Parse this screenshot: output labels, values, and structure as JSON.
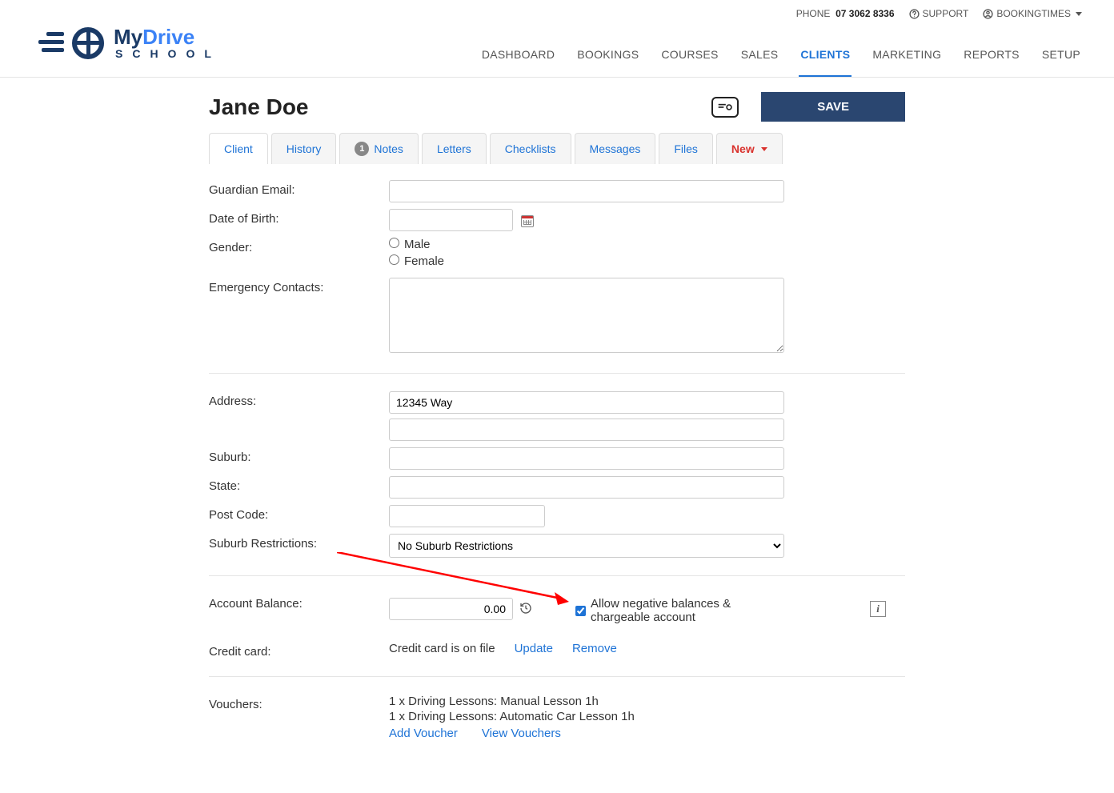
{
  "topbar": {
    "phone_label": "PHONE",
    "phone_number": "07 3062 8336",
    "support_label": "SUPPORT",
    "account_label": "BOOKINGTIMES"
  },
  "logo": {
    "line1a": "My",
    "line1b": "Drive",
    "line2": "SCHOOL"
  },
  "nav": {
    "items": [
      "DASHBOARD",
      "BOOKINGS",
      "COURSES",
      "SALES",
      "CLIENTS",
      "MARKETING",
      "REPORTS",
      "SETUP"
    ],
    "active_index": 4
  },
  "page": {
    "title": "Jane Doe",
    "save_label": "SAVE"
  },
  "tabs": {
    "client": "Client",
    "history": "History",
    "notes": "Notes",
    "notes_count": "1",
    "letters": "Letters",
    "checklists": "Checklists",
    "messages": "Messages",
    "files": "Files",
    "new": "New"
  },
  "form": {
    "guardian_email": {
      "label": "Guardian Email:",
      "value": ""
    },
    "dob": {
      "label": "Date of Birth:",
      "value": ""
    },
    "gender": {
      "label": "Gender:",
      "male": "Male",
      "female": "Female",
      "selected": ""
    },
    "emergency": {
      "label": "Emergency Contacts:",
      "value": ""
    },
    "address": {
      "label": "Address:",
      "line1": "12345 Way",
      "line2": ""
    },
    "suburb": {
      "label": "Suburb:",
      "value": ""
    },
    "state": {
      "label": "State:",
      "value": ""
    },
    "postcode": {
      "label": "Post Code:",
      "value": ""
    },
    "suburb_restrictions": {
      "label": "Suburb Restrictions:",
      "value": "No Suburb Restrictions"
    },
    "account_balance": {
      "label": "Account Balance:",
      "value": "0.00",
      "allow_neg_label": "Allow negative balances & chargeable account",
      "allow_neg_checked": true
    },
    "credit_card": {
      "label": "Credit card:",
      "status": "Credit card is on file",
      "update": "Update",
      "remove": "Remove"
    },
    "vouchers": {
      "label": "Vouchers:",
      "lines": [
        "1 x Driving Lessons: Manual Lesson 1h",
        "1 x Driving Lessons: Automatic Car Lesson 1h"
      ],
      "add": "Add Voucher",
      "view": "View Vouchers"
    }
  }
}
